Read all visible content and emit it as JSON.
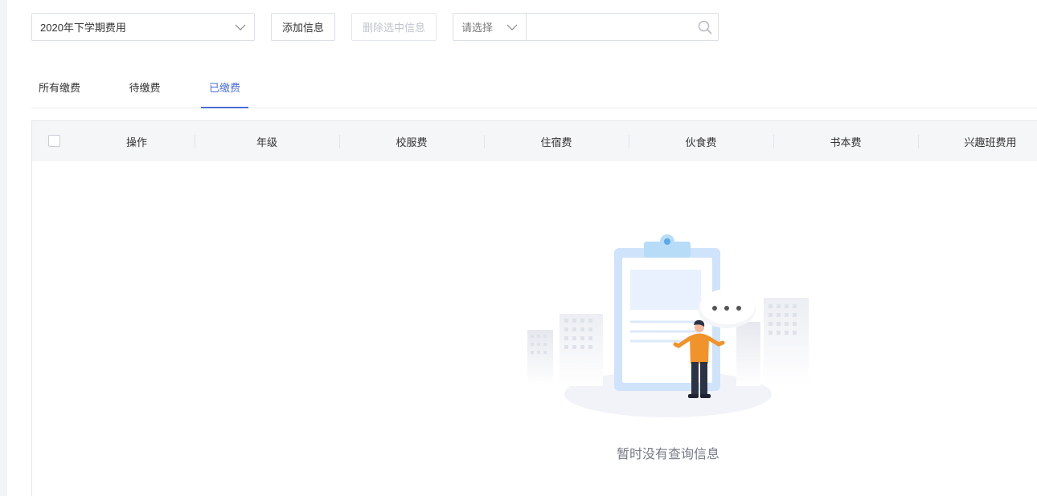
{
  "toolbar": {
    "term_select": {
      "value": "2020年下学期费用",
      "icon": "chevron-down-icon"
    },
    "add_button": "添加信息",
    "delete_button": "删除选中信息",
    "search": {
      "type_placeholder": "请选择",
      "input_value": "",
      "input_placeholder": "",
      "icon": "search-icon"
    }
  },
  "tabs": [
    {
      "label": "所有缴费",
      "active": false
    },
    {
      "label": "待缴费",
      "active": false
    },
    {
      "label": "已缴费",
      "active": true
    }
  ],
  "table": {
    "columns": [
      "操作",
      "年级",
      "校服费",
      "住宿费",
      "伙食费",
      "书本费",
      "兴趣班费用"
    ],
    "rows": [],
    "empty_text": "暂时没有查询信息",
    "empty_icon": "empty-clipboard-illustration"
  },
  "colors": {
    "accent": "#4a6fd4",
    "border": "#dcdfe6",
    "header_bg": "#f5f6f8"
  }
}
